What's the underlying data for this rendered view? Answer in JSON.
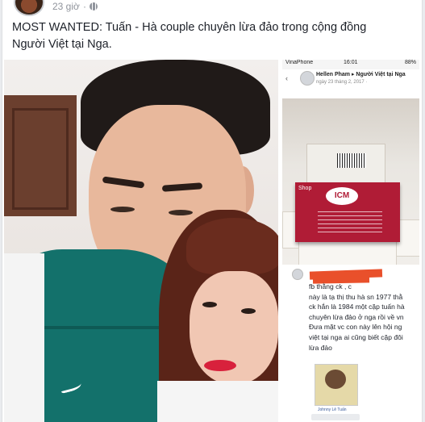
{
  "post": {
    "time": "23 giờ",
    "separator": "·",
    "text": "MOST WANTED: Tuấn - Hà couple chuyên lừa đảo trong cộng đồng Người Việt tại Nga."
  },
  "screenshot_top": {
    "carrier": "VinaPhone",
    "clock": "16:01",
    "battery": "88%",
    "author_line": "Hellen Pham ▸ Người Việt tại Nga",
    "date": "ngày 23 tháng 2, 2017 · ",
    "box_shop": "Shop",
    "box_logo": "ICM"
  },
  "screenshot_bottom": {
    "comment": "fb thằng ck , c\nnày là tạ thị thu hà sn 1977 thằ\nck hắn là 1984 một cặp tuấn hà\nchuyên lừa đảo ở nga rồi về vn\nĐưa mặt vc con này lên hội ng\nviệt tại nga ai cũng biết cặp đôi\nlừa đảo",
    "profile_name": "Johnny Lê Tuấn"
  },
  "colors": {
    "text": "#1d2129",
    "meta": "#90949c",
    "brand_red": "#b01c36",
    "redaction": "#e9502b"
  }
}
